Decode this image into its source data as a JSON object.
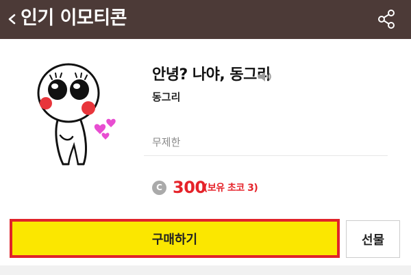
{
  "header": {
    "title": "인기 이모티콘",
    "back_icon": "chevron-left-icon",
    "share_icon": "share-icon",
    "background": "#4c3a37"
  },
  "emoticon": {
    "title": "안녕? 나야, 동그리",
    "author": "동그리",
    "period": "무제한",
    "sound_icon": "speaker-icon"
  },
  "price": {
    "currency_symbol": "C",
    "amount": "300",
    "owned_note": "(보유 초코 3)",
    "accent_color": "#e5232a"
  },
  "actions": {
    "buy_label": "구매하기",
    "gift_label": "선물",
    "buy_color": "#fbe700",
    "highlight_color": "#e0232a"
  }
}
